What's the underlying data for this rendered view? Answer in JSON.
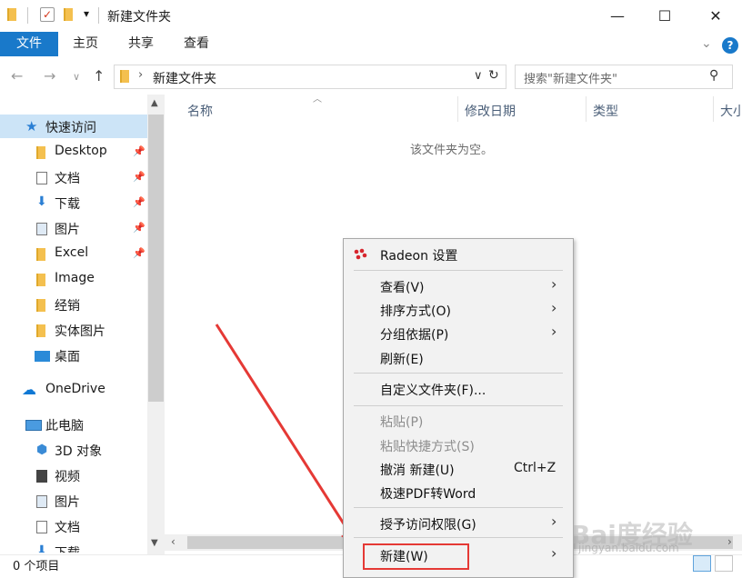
{
  "window": {
    "title": "新建文件夹",
    "minimize": "—",
    "maximize": "☐",
    "close": "✕"
  },
  "ribbon": {
    "file_tab": "文件",
    "tabs": [
      "主页",
      "共享",
      "查看"
    ],
    "collapse_icon": "chevron-down-icon",
    "help": "?"
  },
  "address": {
    "path": "新建文件夹",
    "search_placeholder": "搜索\"新建文件夹\""
  },
  "columns": [
    "名称",
    "修改日期",
    "类型",
    "大小"
  ],
  "empty_message": "该文件夹为空。",
  "navigation": {
    "quick_access": "快速访问",
    "pinned": [
      "Desktop",
      "文档",
      "下载",
      "图片",
      "Excel"
    ],
    "folders": [
      "Image",
      "经销",
      "实体图片",
      "桌面"
    ],
    "onedrive": "OneDrive",
    "this_pc": "此电脑",
    "pc_items": [
      "3D 对象",
      "视频",
      "图片",
      "文档",
      "下载"
    ]
  },
  "status": {
    "item_count": "0 个项目"
  },
  "context_menu": {
    "radeon": "Radeon 设置",
    "view": "查看(V)",
    "sort": "排序方式(O)",
    "group": "分组依据(P)",
    "refresh": "刷新(E)",
    "customize": "自定义文件夹(F)...",
    "paste": "粘贴(P)",
    "paste_shortcut": "粘贴快捷方式(S)",
    "undo": "撤消 新建(U)",
    "undo_shortcut": "Ctrl+Z",
    "pdf": "极速PDF转Word",
    "grant_access": "授予访问权限(G)",
    "new": "新建(W)"
  },
  "watermark": {
    "logo": "Bai度经验",
    "url": "jingyan.baidu.com"
  },
  "colors": {
    "accent": "#1979ca",
    "selection": "#cce4f7",
    "annotation": "#e53935"
  }
}
